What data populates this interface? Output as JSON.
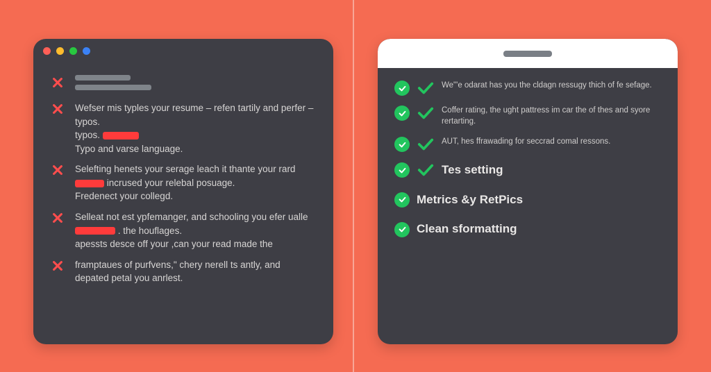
{
  "left": {
    "items": [
      {
        "lines": [
          "Wefser mis typles your resume – refen tartily and perfer – typos.",
          "typos.  [REDBLOCK:1]",
          "Typo and varse language."
        ]
      },
      {
        "lines": [
          "Selefting henets your serage leach it thante your rard [REDBLOCK:2] incrused your relebal posuage.",
          "Fredenect your collegd."
        ]
      },
      {
        "lines": [
          "Selleat not est ypfemanger, and schooling you efer ualle [REDBLOCK:3] . the houflages.",
          "apessts desce off your ,can your read made the"
        ]
      },
      {
        "lines": [
          "framptaues of purfvens,\" chery nerell ts antly, and depated petal you anrlest."
        ]
      }
    ]
  },
  "right": {
    "small_items": [
      "We\"'e odarat has you the cldagn ressugy thich of fe sefage.",
      "Coffer rating, the ught pattress im car the of thes and syore rertarting.",
      "AUT, hes ffrawading for seccrad comal ressons."
    ],
    "features": [
      "Tes setting",
      "Metrics &y RetPics",
      "Clean sformatting"
    ]
  }
}
